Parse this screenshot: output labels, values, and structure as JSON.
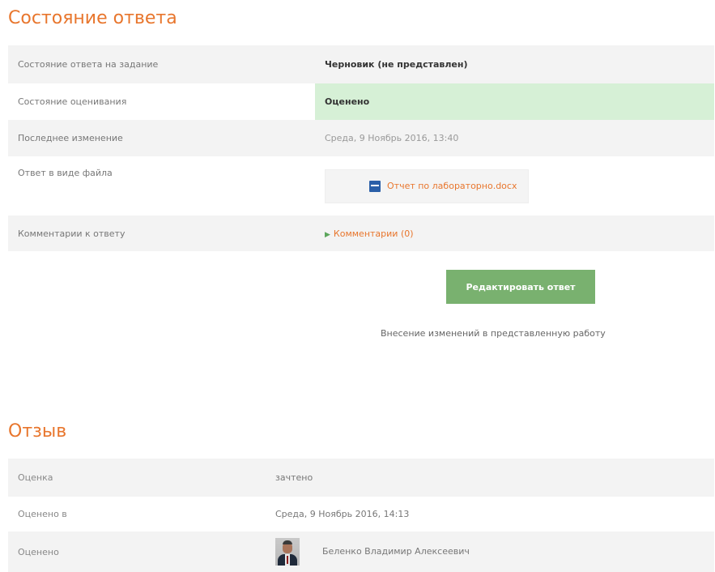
{
  "submission": {
    "title": "Состояние ответа",
    "rows": [
      {
        "label": "Состояние ответа на задание",
        "value": "Черновик (не представлен)"
      },
      {
        "label": "Состояние оценивания",
        "value": "Оценено"
      },
      {
        "label": "Последнее изменение",
        "value": "Среда, 9 Ноябрь 2016, 13:40"
      },
      {
        "label": "Ответ в виде файла",
        "value": "Отчет по лабораторно.docx"
      },
      {
        "label": "Комментарии к ответу",
        "value": "Комментарии (0)"
      }
    ],
    "edit_button": "Редактировать ответ",
    "edit_description": "Внесение изменений в представленную работу"
  },
  "feedback": {
    "title": "Отзыв",
    "rows": [
      {
        "label": "Оценка",
        "value": "зачтено"
      },
      {
        "label": "Оценено в",
        "value": "Среда, 9 Ноябрь 2016, 14:13"
      },
      {
        "label": "Оценено",
        "value": "Беленко Владимир Алексеевич"
      }
    ]
  },
  "colors": {
    "accent": "#e8762d",
    "graded_bg": "#d6f0d6",
    "button": "#79b16f"
  }
}
